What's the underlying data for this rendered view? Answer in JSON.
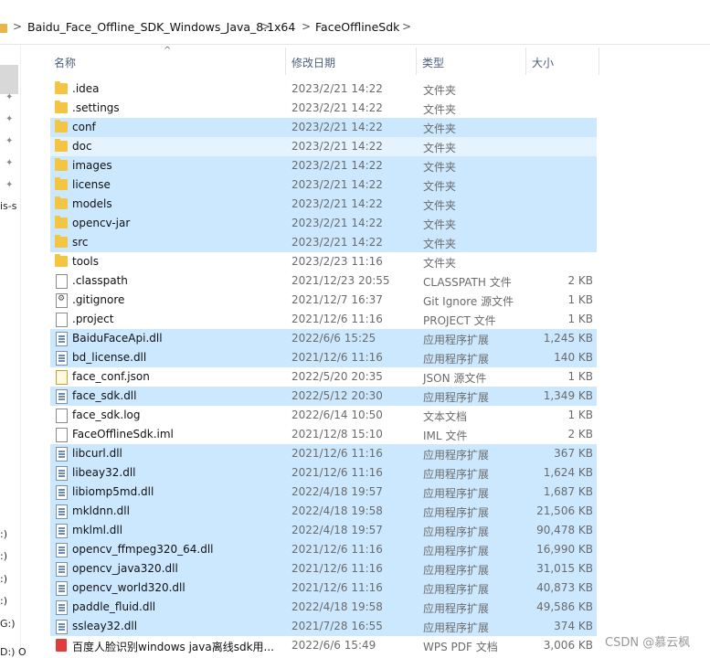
{
  "addressbar": {
    "crumbs": [
      "Baidu_Face_Offline_SDK_Windows_Java_8.1",
      "x64",
      "FaceOfflineSdk"
    ],
    "separator": ">",
    "dropdown": "⌄"
  },
  "navpane": {
    "fragments": [
      "is-s",
      ":)",
      ":)",
      ":)",
      ":)",
      "G:)",
      "D:) O"
    ]
  },
  "columns": {
    "name": "名称",
    "date": "修改日期",
    "type": "类型",
    "size": "大小",
    "sort_indicator": "^"
  },
  "files": [
    {
      "name": ".idea",
      "date": "2023/2/21 14:22",
      "type": "文件夹",
      "size": "",
      "icon": "folder-icon",
      "state": ""
    },
    {
      "name": ".settings",
      "date": "2023/2/21 14:22",
      "type": "文件夹",
      "size": "",
      "icon": "folder-icon",
      "state": ""
    },
    {
      "name": "conf",
      "date": "2023/2/21 14:22",
      "type": "文件夹",
      "size": "",
      "icon": "folder-icon",
      "state": "sel"
    },
    {
      "name": "doc",
      "date": "2023/2/21 14:22",
      "type": "文件夹",
      "size": "",
      "icon": "folder-icon",
      "state": "hov"
    },
    {
      "name": "images",
      "date": "2023/2/21 14:22",
      "type": "文件夹",
      "size": "",
      "icon": "folder-icon",
      "state": "sel"
    },
    {
      "name": "license",
      "date": "2023/2/21 14:22",
      "type": "文件夹",
      "size": "",
      "icon": "folder-icon",
      "state": "sel"
    },
    {
      "name": "models",
      "date": "2023/2/21 14:22",
      "type": "文件夹",
      "size": "",
      "icon": "folder-icon",
      "state": "sel"
    },
    {
      "name": "opencv-jar",
      "date": "2023/2/21 14:22",
      "type": "文件夹",
      "size": "",
      "icon": "folder-icon",
      "state": "sel"
    },
    {
      "name": "src",
      "date": "2023/2/21 14:22",
      "type": "文件夹",
      "size": "",
      "icon": "folder-icon",
      "state": "sel"
    },
    {
      "name": "tools",
      "date": "2023/2/23 11:16",
      "type": "文件夹",
      "size": "",
      "icon": "folder-icon",
      "state": ""
    },
    {
      "name": ".classpath",
      "date": "2021/12/23 20:55",
      "type": "CLASSPATH 文件",
      "size": "2 KB",
      "icon": "file-icon",
      "state": ""
    },
    {
      "name": ".gitignore",
      "date": "2021/12/7 16:37",
      "type": "Git Ignore 源文件",
      "size": "1 KB",
      "icon": "gear-file-icon",
      "state": ""
    },
    {
      "name": ".project",
      "date": "2021/12/6 11:16",
      "type": "PROJECT 文件",
      "size": "1 KB",
      "icon": "file-icon",
      "state": ""
    },
    {
      "name": "BaiduFaceApi.dll",
      "date": "2022/6/6 15:25",
      "type": "应用程序扩展",
      "size": "1,245 KB",
      "icon": "dll-icon",
      "state": "sel"
    },
    {
      "name": "bd_license.dll",
      "date": "2021/12/6 11:16",
      "type": "应用程序扩展",
      "size": "140 KB",
      "icon": "dll-icon",
      "state": "sel"
    },
    {
      "name": "face_conf.json",
      "date": "2022/5/20 20:35",
      "type": "JSON 源文件",
      "size": "1 KB",
      "icon": "json-icon",
      "state": ""
    },
    {
      "name": "face_sdk.dll",
      "date": "2022/5/12 20:30",
      "type": "应用程序扩展",
      "size": "1,349 KB",
      "icon": "dll-icon",
      "state": "sel"
    },
    {
      "name": "face_sdk.log",
      "date": "2022/6/14 10:50",
      "type": "文本文档",
      "size": "1 KB",
      "icon": "file-icon",
      "state": ""
    },
    {
      "name": "FaceOfflineSdk.iml",
      "date": "2021/12/8 15:10",
      "type": "IML 文件",
      "size": "2 KB",
      "icon": "file-icon",
      "state": ""
    },
    {
      "name": "libcurl.dll",
      "date": "2021/12/6 11:16",
      "type": "应用程序扩展",
      "size": "367 KB",
      "icon": "dll-icon",
      "state": "sel"
    },
    {
      "name": "libeay32.dll",
      "date": "2021/12/6 11:16",
      "type": "应用程序扩展",
      "size": "1,624 KB",
      "icon": "dll-icon",
      "state": "sel"
    },
    {
      "name": "libiomp5md.dll",
      "date": "2022/4/18 19:57",
      "type": "应用程序扩展",
      "size": "1,687 KB",
      "icon": "dll-icon",
      "state": "sel"
    },
    {
      "name": "mkldnn.dll",
      "date": "2022/4/18 19:58",
      "type": "应用程序扩展",
      "size": "21,506 KB",
      "icon": "dll-icon",
      "state": "sel"
    },
    {
      "name": "mklml.dll",
      "date": "2022/4/18 19:57",
      "type": "应用程序扩展",
      "size": "90,478 KB",
      "icon": "dll-icon",
      "state": "sel"
    },
    {
      "name": "opencv_ffmpeg320_64.dll",
      "date": "2021/12/6 11:16",
      "type": "应用程序扩展",
      "size": "16,990 KB",
      "icon": "dll-icon",
      "state": "sel"
    },
    {
      "name": "opencv_java320.dll",
      "date": "2021/12/6 11:16",
      "type": "应用程序扩展",
      "size": "31,015 KB",
      "icon": "dll-icon",
      "state": "sel"
    },
    {
      "name": "opencv_world320.dll",
      "date": "2021/12/6 11:16",
      "type": "应用程序扩展",
      "size": "40,873 KB",
      "icon": "dll-icon",
      "state": "sel"
    },
    {
      "name": "paddle_fluid.dll",
      "date": "2022/4/18 19:58",
      "type": "应用程序扩展",
      "size": "49,586 KB",
      "icon": "dll-icon",
      "state": "sel"
    },
    {
      "name": "ssleay32.dll",
      "date": "2021/7/28 16:55",
      "type": "应用程序扩展",
      "size": "374 KB",
      "icon": "dll-icon",
      "state": "sel"
    },
    {
      "name": "百度人脸识别windows java离线sdk用...",
      "date": "2022/6/6 15:49",
      "type": "WPS PDF 文档",
      "size": "3,006 KB",
      "icon": "pdf-icon",
      "state": ""
    }
  ],
  "watermark": "CSDN @慕云枫",
  "colors": {
    "selected": "#cce8ff",
    "hover": "#e5f3ff",
    "folder": "#f4c542"
  }
}
